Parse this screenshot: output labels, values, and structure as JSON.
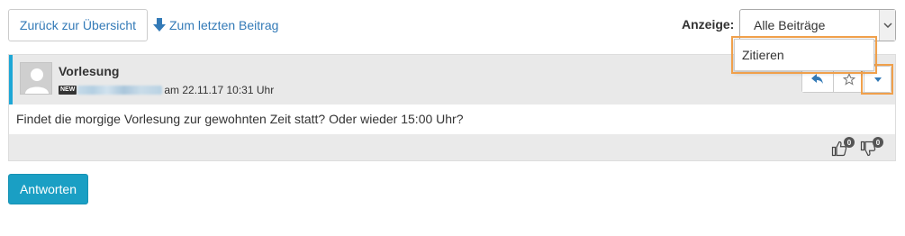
{
  "toolbar": {
    "back_label": "Zurück zur Übersicht",
    "last_post_label": "Zum letzten Beitrag",
    "display_label": "Anzeige:",
    "display_selected": "Alle Beiträge"
  },
  "post": {
    "title": "Vorlesung",
    "new_badge": "NEW",
    "date_text": "am 22.11.17 10:31 Uhr",
    "body": "Findet die morgige Vorlesung zur gewohnten Zeit statt? Oder wieder 15:00 Uhr?",
    "actions": {
      "reply_icon": "reply-icon",
      "favorite_icon": "star-icon",
      "menu_icon": "caret-down-icon"
    },
    "dropdown_items": [
      "Zitieren"
    ],
    "likes": "0",
    "dislikes": "0"
  },
  "footer": {
    "reply_button_label": "Antworten"
  },
  "colors": {
    "accent_blue": "#1ea7d6",
    "link_blue": "#337ab7",
    "highlight_orange": "#f0a04b",
    "primary_button": "#1a9fc4"
  }
}
